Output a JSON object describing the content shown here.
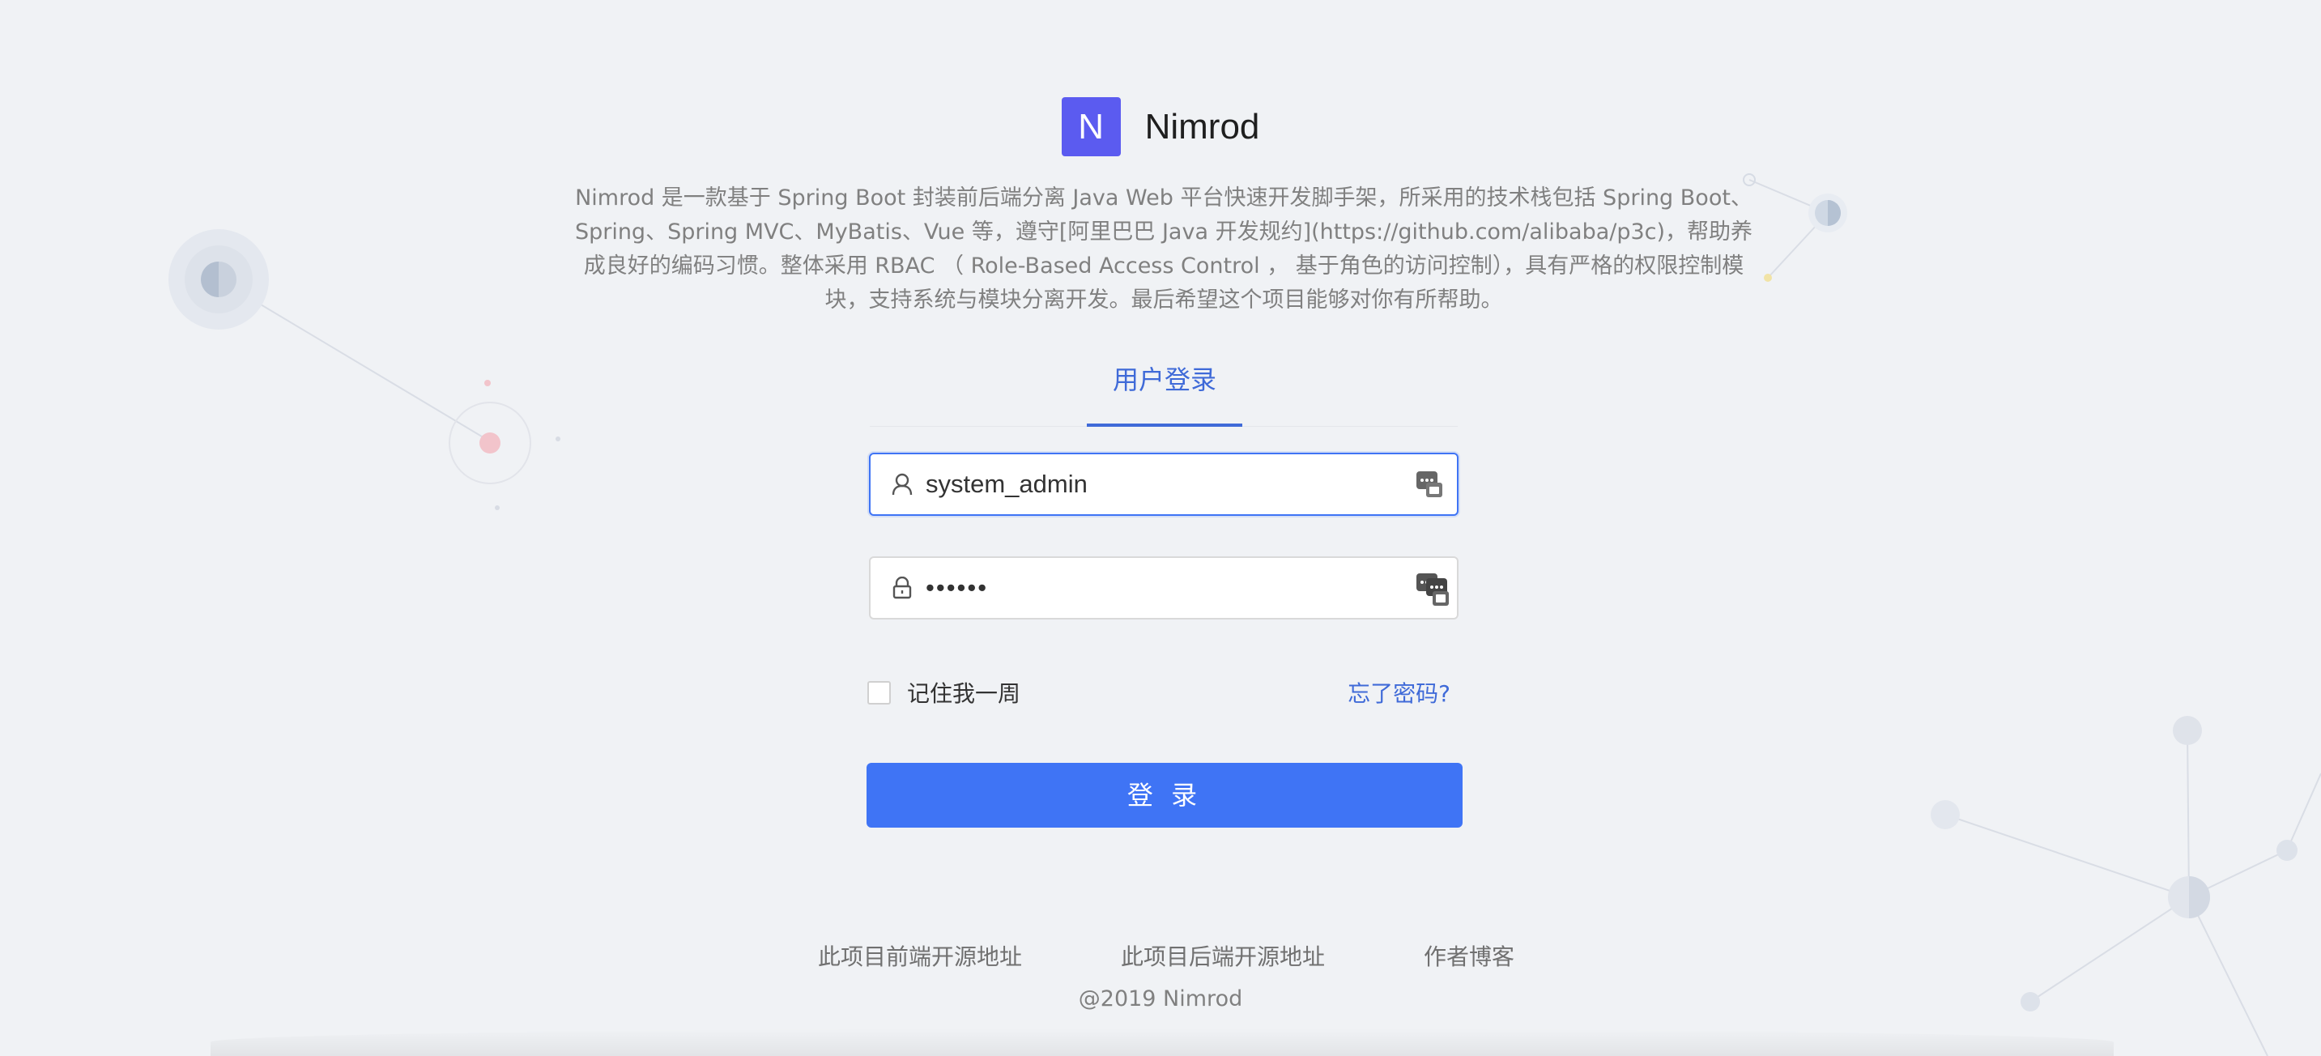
{
  "brand": {
    "logo_letter": "N",
    "app_name": "Nimrod",
    "logo_color": "#5b5bf0"
  },
  "description": "Nimrod 是一款基于 Spring Boot 封装前后端分离 Java Web 平台快速开发脚手架，所采用的技术栈包括 Spring Boot、Spring、Spring MVC、MyBatis、Vue 等，遵守[阿里巴巴 Java 开发规约](https://github.com/alibaba/p3c)，帮助养成良好的编码习惯。整体采用 RBAC （ Role-Based Access Control ， 基于角色的访问控制），具有严格的权限控制模块，支持系统与模块分离开发。最后希望这个项目能够对你有所帮助。",
  "tabs": [
    {
      "label": "用户登录",
      "active": true
    }
  ],
  "form": {
    "username_value": "system_admin",
    "password_value": "••••••",
    "remember_label": "记住我一周",
    "remember_checked": false,
    "forgot_label": "忘了密码?",
    "submit_label": "登 录"
  },
  "footer": {
    "links": [
      "此项目前端开源地址",
      "此项目后端开源地址",
      "作者博客"
    ],
    "copyright": "@2019 Nimrod"
  },
  "colors": {
    "accent": "#3f74f5",
    "link": "#3f6ad8",
    "background": "#f0f2f5"
  },
  "icons": {
    "username": "user-icon",
    "password": "lock-icon",
    "password_manager": "password-manager-icon"
  }
}
